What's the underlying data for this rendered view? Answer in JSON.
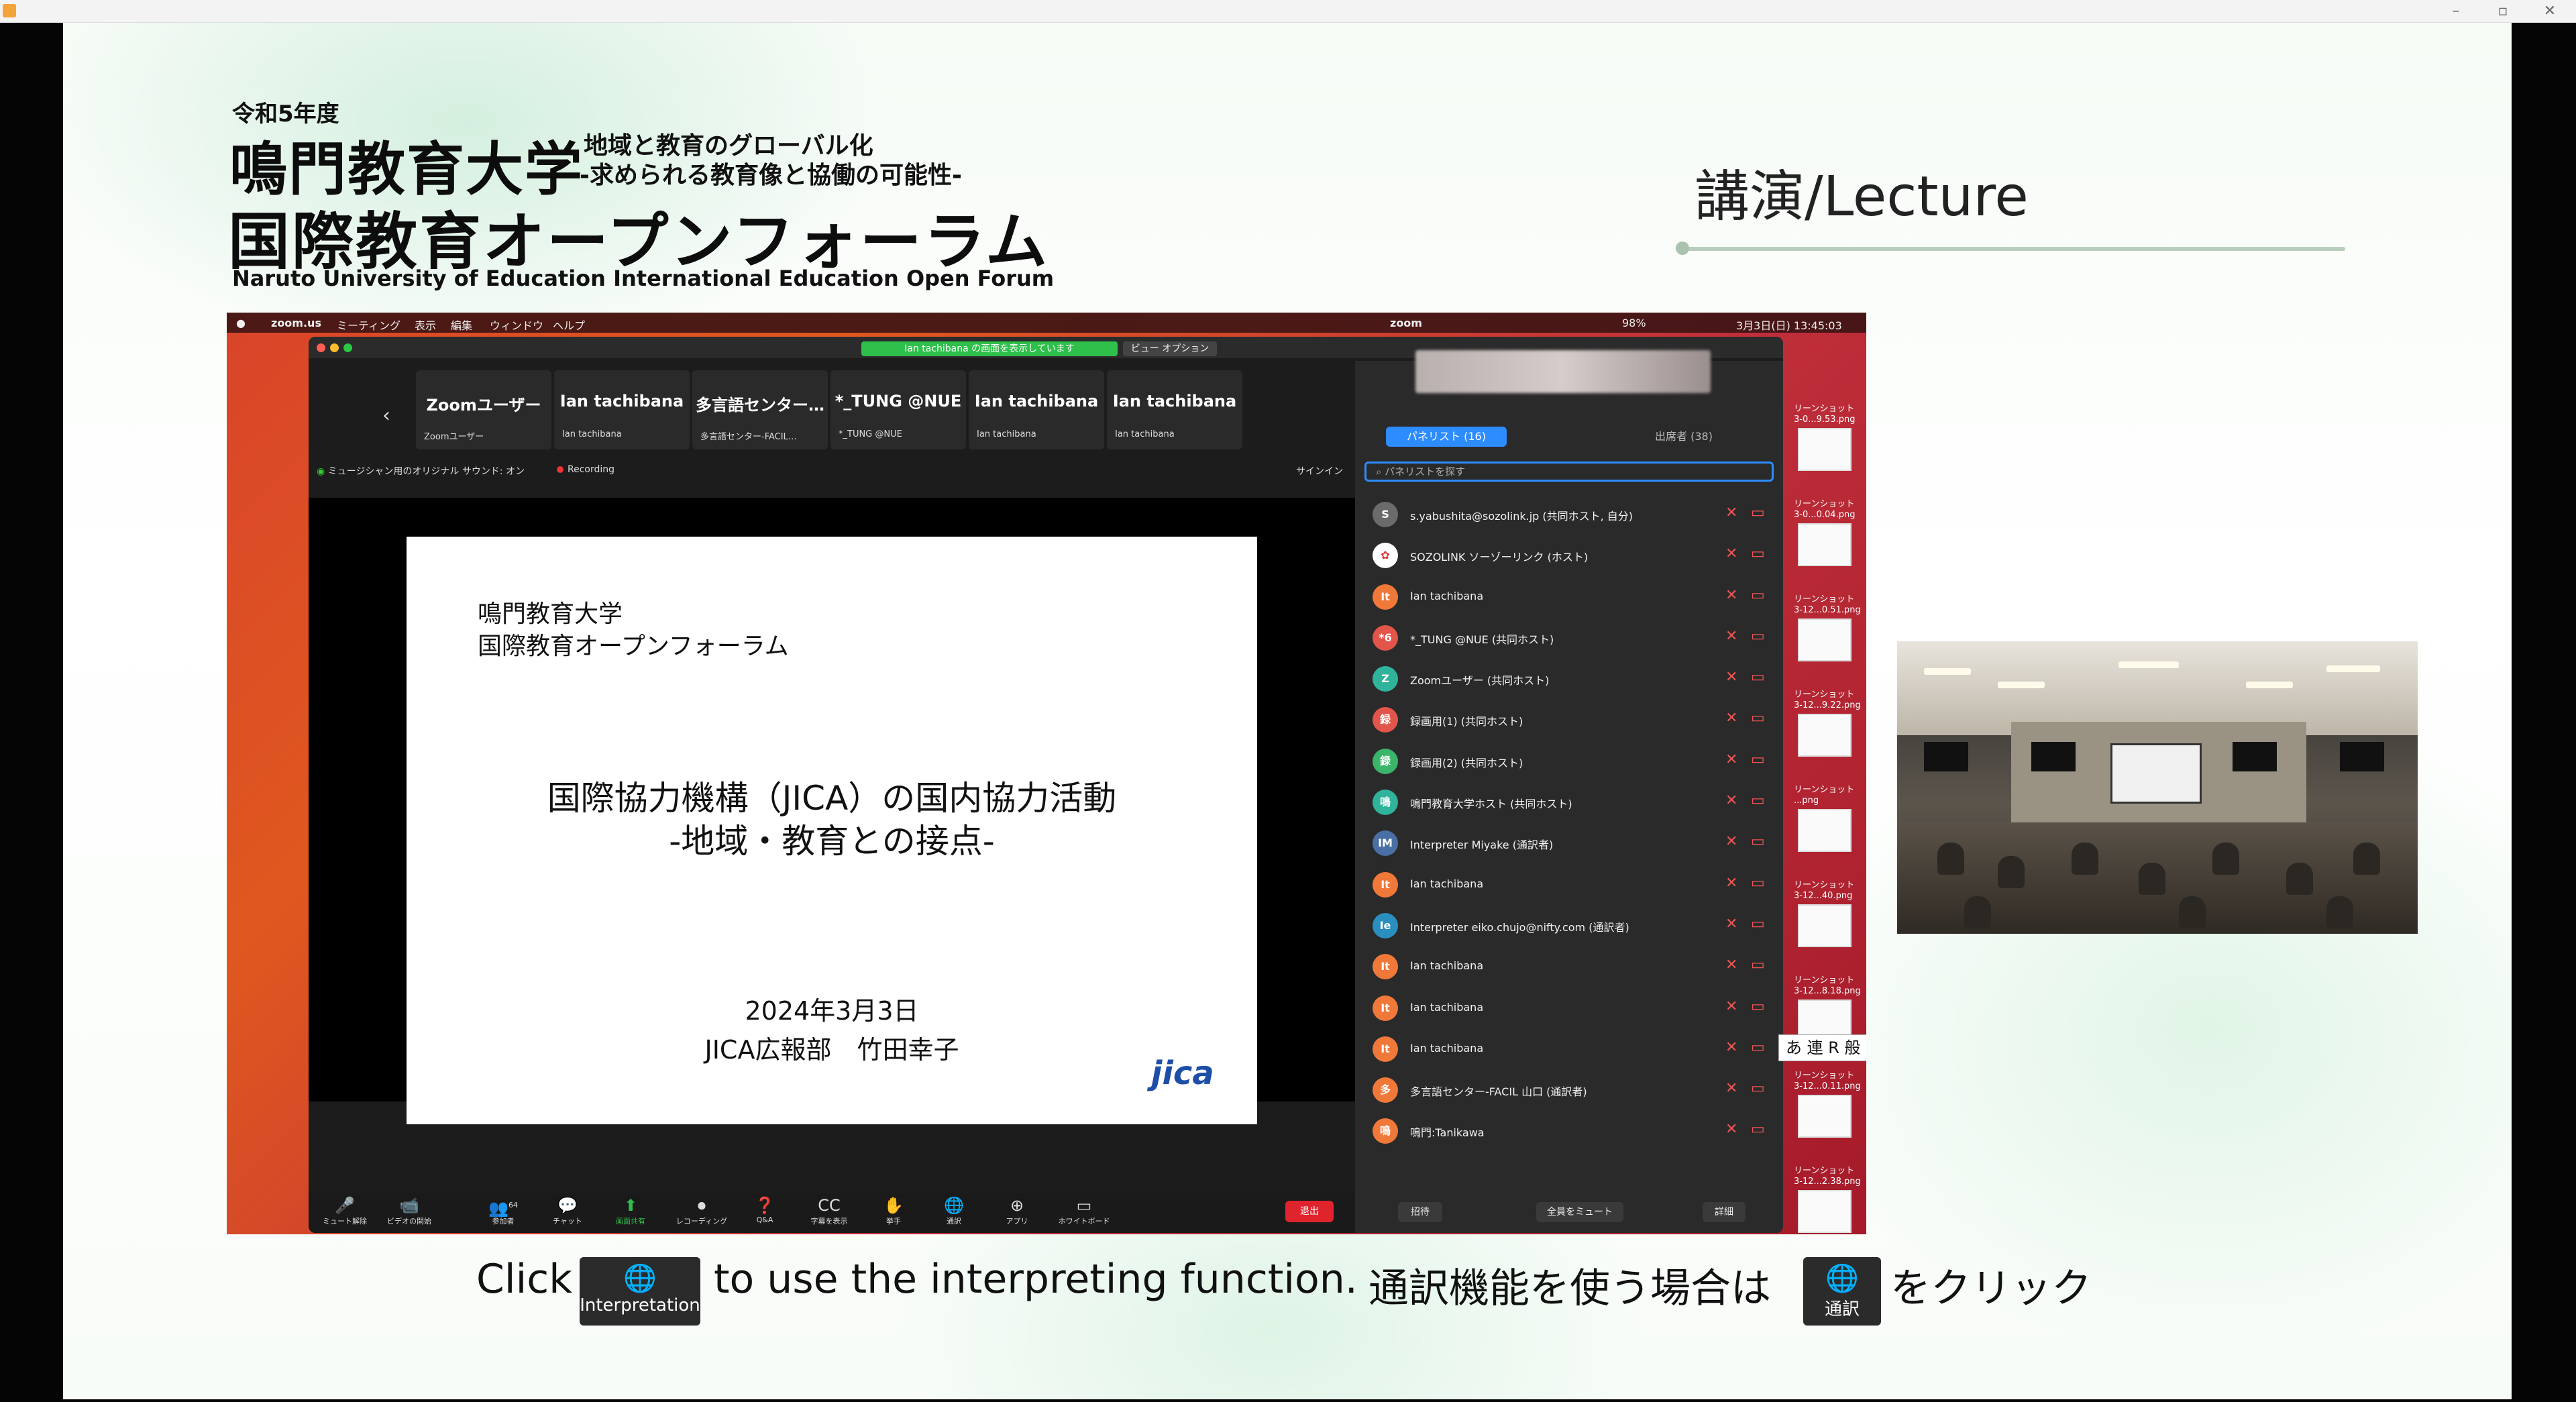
{
  "window": {
    "minimize": "–",
    "maximize": "▫",
    "close": "✕"
  },
  "header": {
    "year": "令和5年度",
    "university": "鳴門教育大学",
    "theme_line1": "地域と教育のグローバル化",
    "theme_line2": "-求められる教育像と協働の可能性-",
    "forum": "国際教育オープンフォーラム",
    "forum_en": "Naruto University of Education International Education Open Forum",
    "section": "講演/Lecture"
  },
  "mac_menu": {
    "items": [
      "zoom.us",
      "ミーティング",
      "表示",
      "編集",
      "ウィンドウ",
      "ヘルプ"
    ],
    "right": "3月3日(日) 13:45:03",
    "battery": "98%",
    "app": "zoom"
  },
  "zoom": {
    "share_notice": "Ian tachibana の画面を表示しています",
    "view_options": "ビュー オプション",
    "hide_label": "表示",
    "status_audio": "ミュージシャン用のオリジナル サウンド: オン",
    "recording": "Recording",
    "sign_in": "サインイン",
    "thumbnails": [
      {
        "name": "Zoomユーザー",
        "sub": "Zoomユーザー"
      },
      {
        "name": "Ian tachibana",
        "sub": "Ian tachibana"
      },
      {
        "name": "多言語センター…",
        "sub": "多言語センター-FACIL…"
      },
      {
        "name": "*_TUNG @NUE",
        "sub": "*_TUNG @NUE"
      },
      {
        "name": "Ian tachibana",
        "sub": "Ian tachibana"
      },
      {
        "name": "Ian tachibana",
        "sub": "Ian tachibana"
      }
    ],
    "slide": {
      "univ1": "鳴門教育大学",
      "univ2": "国際教育オープンフォーラム",
      "title": "国際協力機構（JICA）の国内協力活動",
      "subtitle": "-地域・教育との接点-",
      "date": "2024年3月3日",
      "dept": "JICA広報部　竹田幸子",
      "logo": "jica"
    },
    "toolbar": [
      {
        "icon": "🎤",
        "label": "ミュート解除"
      },
      {
        "icon": "📹",
        "label": "ビデオの開始"
      },
      {
        "icon": "👥",
        "label": "参加者",
        "count": "64"
      },
      {
        "icon": "💬",
        "label": "チャット"
      },
      {
        "icon": "⬆",
        "label": "画面共有"
      },
      {
        "icon": "⏺",
        "label": "レコーディング"
      },
      {
        "icon": "❓",
        "label": "Q&A"
      },
      {
        "icon": "CC",
        "label": "字幕を表示"
      },
      {
        "icon": "✋",
        "label": "挙手"
      },
      {
        "icon": "🌐",
        "label": "通訳"
      },
      {
        "icon": "⊕",
        "label": "アプリ"
      },
      {
        "icon": "▭",
        "label": "ホワイトボード"
      }
    ],
    "leave": "退出",
    "panel": {
      "tab_panelists": "パネリスト (16)",
      "tab_attendees": "出席者 (38)",
      "search_placeholder": "パネリストを探す",
      "participants": [
        {
          "initial": "S",
          "color": "#6b6b6b",
          "name": "s.yabushita@sozolink.jp (共同ホスト, 自分)"
        },
        {
          "initial": "✿",
          "color": "#ffffff",
          "name": "SOZOLINK ソーゾーリンク (ホスト)"
        },
        {
          "initial": "It",
          "color": "#f0793a",
          "name": "Ian tachibana"
        },
        {
          "initial": "*6",
          "color": "#e2554b",
          "name": "*_TUNG @NUE (共同ホスト)"
        },
        {
          "initial": "Z",
          "color": "#2fb39a",
          "name": "Zoomユーザー (共同ホスト)"
        },
        {
          "initial": "録",
          "color": "#e2554b",
          "name": "録画用(1) (共同ホスト)"
        },
        {
          "initial": "録",
          "color": "#3bb56a",
          "name": "録画用(2) (共同ホスト)"
        },
        {
          "initial": "鳴",
          "color": "#2fb39a",
          "name": "鳴門教育大学ホスト (共同ホスト)"
        },
        {
          "initial": "IM",
          "color": "#4a6fa5",
          "name": "Interpreter Miyake (通訳者)"
        },
        {
          "initial": "It",
          "color": "#f0793a",
          "name": "Ian tachibana"
        },
        {
          "initial": "Ie",
          "color": "#2a8fbf",
          "name": "Interpreter eiko.chujo@nifty.com (通訳者)"
        },
        {
          "initial": "It",
          "color": "#f0793a",
          "name": "Ian tachibana"
        },
        {
          "initial": "It",
          "color": "#f0793a",
          "name": "Ian tachibana"
        },
        {
          "initial": "It",
          "color": "#f0793a",
          "name": "Ian tachibana"
        },
        {
          "initial": "多",
          "color": "#f0793a",
          "name": "多言語センター-FACIL 山口 (通訳者)"
        },
        {
          "initial": "鳴",
          "color": "#f0793a",
          "name": "鳴門:Tanikawa"
        }
      ],
      "invite": "招待",
      "mute_all": "全員をミュート",
      "more": "詳細"
    },
    "desktop_files": [
      {
        "label": "リーンショット\n3-0...9.53.png"
      },
      {
        "label": "リーンショット\n3-0...0.04.png"
      },
      {
        "label": "リーンショット\n3-12...0.51.png"
      },
      {
        "label": "リーンショット\n3-12...9.22.png"
      },
      {
        "label": "リーンショット\n...png"
      },
      {
        "label": "リーンショット\n3-12...40.png"
      },
      {
        "label": "リーンショット\n3-12...8.18.png"
      },
      {
        "label": "リーンショット\n3-12...0.11.png"
      },
      {
        "label": "リーンショット\n3-12...2.38.png"
      }
    ],
    "ime": "あ 連 R 般"
  },
  "instruction": {
    "en_prefix": "Click",
    "en_button": "Interpretation",
    "en_suffix": "to use the interpreting function.",
    "ja_prefix": "通訳機能を使う場合は",
    "ja_button": "通訳",
    "ja_suffix": "をクリック"
  }
}
